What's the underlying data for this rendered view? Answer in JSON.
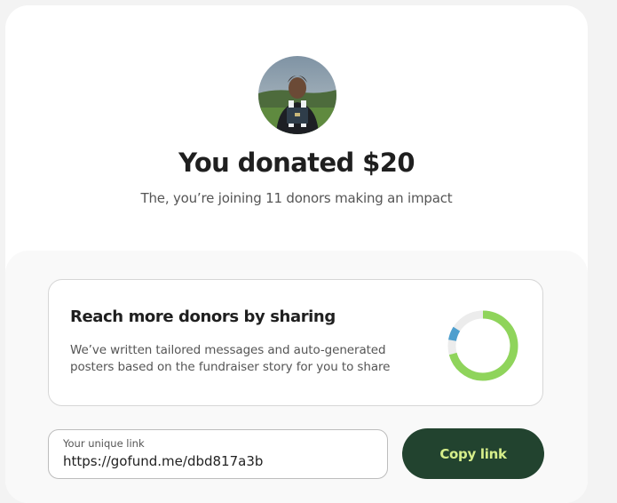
{
  "header": {
    "title": "You donated $20",
    "subtitle": "The, you’re joining 11 donors making an impact"
  },
  "share": {
    "title": "Reach more donors by sharing",
    "description": "We’ve written tailored messages and auto-generated posters based on the fundraiser story for you to share",
    "icon": "share-progress-ring-icon",
    "ring_colors": [
      "#8fd45b",
      "#4e9fce",
      "#ececec"
    ]
  },
  "link": {
    "label": "Your unique link",
    "value": "https://gofund.me/dbd817a3b"
  },
  "copy_button": {
    "label": "Copy link"
  },
  "colors": {
    "button_bg": "#22432f",
    "button_text": "#d6ee8a",
    "accent_green": "#8fd45b"
  }
}
